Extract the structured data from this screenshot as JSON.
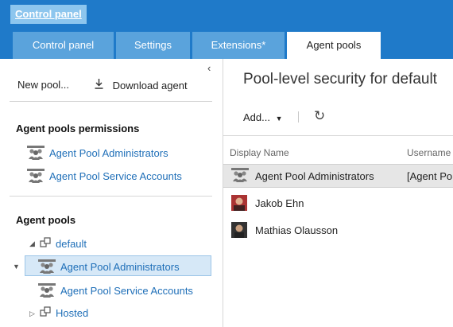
{
  "header": {
    "title": "Control panel",
    "tabs": [
      {
        "label": "Control panel"
      },
      {
        "label": "Settings"
      },
      {
        "label": "Extensions*"
      },
      {
        "label": "Agent pools"
      }
    ]
  },
  "left": {
    "toolbar": {
      "new_pool": "New pool...",
      "download_agent": "Download agent"
    },
    "permissions": {
      "title": "Agent pools permissions",
      "items": [
        "Agent Pool Administrators",
        "Agent Pool Service Accounts"
      ]
    },
    "pools": {
      "title": "Agent pools",
      "default": "default",
      "children": [
        "Agent Pool Administrators",
        "Agent Pool Service Accounts"
      ],
      "hosted": "Hosted"
    }
  },
  "right": {
    "title": "Pool-level security for default",
    "add_label": "Add...",
    "columns": [
      "Display Name",
      "Username"
    ],
    "rows": [
      {
        "name": "Agent Pool Administrators",
        "username": "[Agent Po",
        "icon": "group-icon"
      },
      {
        "name": "Jakob Ehn",
        "username": "",
        "icon": "user-photo-icon"
      },
      {
        "name": "Mathias Olausson",
        "username": "",
        "icon": "user-photo-icon"
      }
    ]
  },
  "colors": {
    "accent": "#1f7ac9",
    "tab": "#5aa3dc",
    "link": "#1f6fb8",
    "selection": "#d6e8f7"
  }
}
